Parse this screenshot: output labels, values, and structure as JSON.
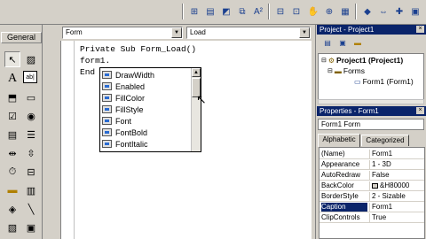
{
  "toolbar": {
    "icons": [
      "toolbox-icon",
      "properties-icon",
      "paint-icon",
      "font-icon",
      "align-icon",
      "bring-front-icon",
      "lock-icon",
      "hand-icon",
      "anchor-icon",
      "dock-icon",
      "grid-icon",
      "toolbox-alt-icon"
    ]
  },
  "toolbox": {
    "header": "General",
    "text_tool": "A",
    "textbox_tool": "ab|"
  },
  "code_window": {
    "object_combo": "Form",
    "procedure_combo": "Load",
    "lines": [
      "Private Sub Form_Load()",
      "form1.",
      "End"
    ]
  },
  "autocomplete": {
    "items": [
      "DrawWidth",
      "Enabled",
      "FillColor",
      "FillStyle",
      "Font",
      "FontBold",
      "FontItalic"
    ]
  },
  "project_explorer": {
    "title": "Project - Project1",
    "tree": {
      "project": "Project1 (Project1)",
      "folder": "Forms",
      "form": "Form1 (Form1)"
    }
  },
  "properties": {
    "title": "Properties - Form1",
    "object_select": "Form1 Form",
    "tabs": [
      "Alphabetic",
      "Categorized"
    ],
    "active_tab": "Alphabetic",
    "rows": [
      {
        "name": "(Name)",
        "value": "Form1"
      },
      {
        "name": "Appearance",
        "value": "1 - 3D"
      },
      {
        "name": "AutoRedraw",
        "value": "False"
      },
      {
        "name": "BackColor",
        "value": "&H80000"
      },
      {
        "name": "BorderStyle",
        "value": "2 - Sizable"
      },
      {
        "name": "Caption",
        "value": "Form1"
      },
      {
        "name": "ClipControls",
        "value": "True"
      }
    ],
    "selected_row": "Caption"
  },
  "colors": {
    "titlebar": "#0a246a",
    "chrome": "#d4d0c8"
  }
}
